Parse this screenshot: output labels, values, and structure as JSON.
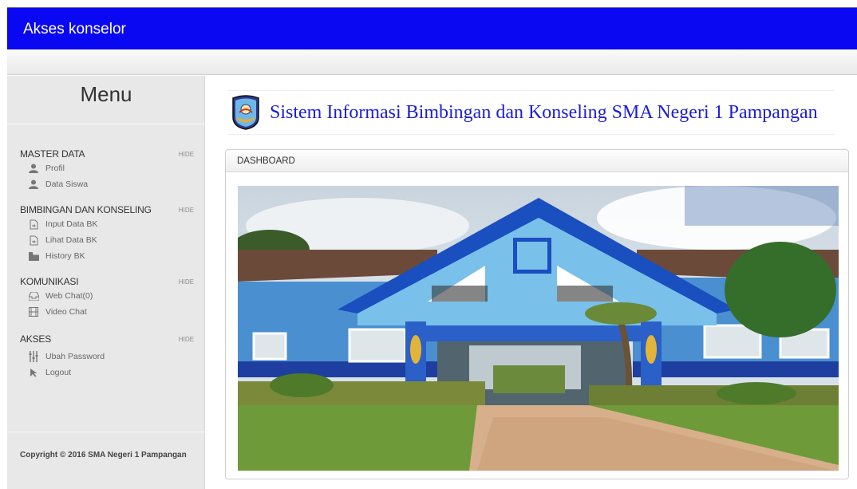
{
  "app": {
    "title": "Akses konselor"
  },
  "sidebar": {
    "menu_title": "Menu",
    "sections": [
      {
        "name": "MASTER DATA",
        "hide": "HIDE",
        "items": [
          {
            "label": "Profil",
            "icon": "user-icon"
          },
          {
            "label": "Data Siswa",
            "icon": "user-icon"
          }
        ]
      },
      {
        "name": "BIMBINGAN DAN KONSELING",
        "hide": "HIDE",
        "items": [
          {
            "label": "Input Data BK",
            "icon": "file-import-icon"
          },
          {
            "label": "Lihat Data BK",
            "icon": "file-import-icon"
          },
          {
            "label": "History BK",
            "icon": "folder-icon"
          }
        ]
      },
      {
        "name": "KOMUNIKASI",
        "hide": "HIDE",
        "items": [
          {
            "label": "Web Chat(0)",
            "icon": "inbox-icon"
          },
          {
            "label": "Video Chat",
            "icon": "film-icon"
          }
        ]
      },
      {
        "name": "AKSES",
        "hide": "HIDE",
        "items": [
          {
            "label": "Ubah Password",
            "icon": "sliders-icon"
          },
          {
            "label": "Logout",
            "icon": "cursor-icon"
          }
        ]
      }
    ],
    "copyright": "Copyright © 2016 SMA Negeri 1 Pampangan"
  },
  "main": {
    "brand_title": "Sistem Informasi Bimbingan dan Konseling SMA Negeri 1 Pampangan",
    "panel_title": "DASHBOARD"
  },
  "colors": {
    "topbar": "#0a08f3",
    "brand_text": "#1c1cd8"
  }
}
